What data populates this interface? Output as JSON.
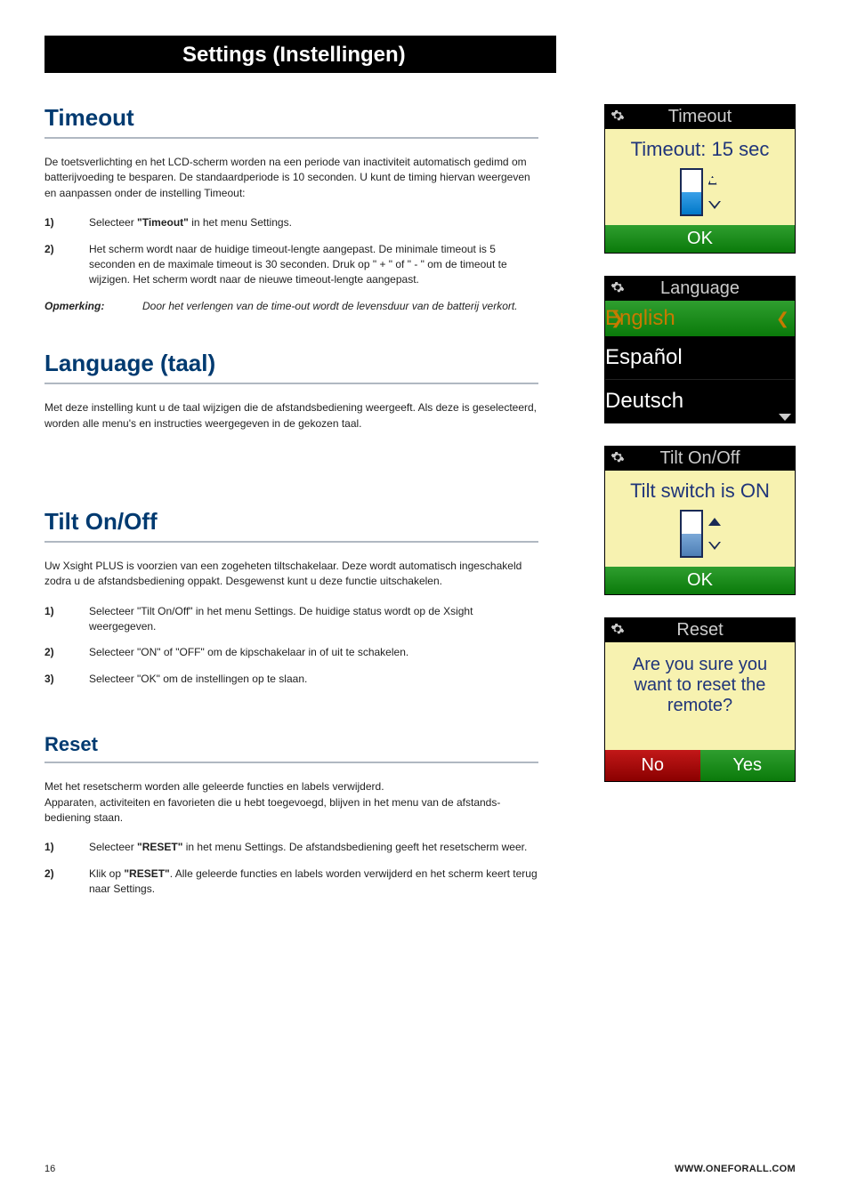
{
  "header": "Settings (Instellingen)",
  "sections": {
    "timeout": {
      "title": "Timeout",
      "intro": "De toetsverlichting en het LCD-scherm worden na een periode van inactiviteit automatisch gedimd om batterijvoeding te besparen. De standaardperiode is 10 seconden. U kunt de timing hiervan weergeven en aanpassen onder de instelling Timeout:",
      "steps": [
        {
          "num": "1)",
          "pre": "Selecteer ",
          "bold": "\"Timeout\"",
          "post": " in het menu Settings."
        },
        {
          "num": "2)",
          "text": "Het scherm wordt naar de huidige timeout-lengte aangepast. De minimale timeout is 5 seconden en de maximale timeout is 30 seconden. Druk op \" + \" of \" - \" om de timeout te wijzigen. Het scherm  wordt naar de nieuwe timeout-lengte aangepast."
        }
      ],
      "note_label": "Opmerking",
      "note_text": "Door het verlengen van de time-out wordt de levensduur van de batterij verkort."
    },
    "language": {
      "title": "Language (taal)",
      "intro": "Met deze instelling kunt u de taal wijzigen die de afstandsbediening weergeeft. Als deze is geselecteerd, worden alle menu's en instructies weergegeven in de gekozen taal."
    },
    "tilt": {
      "title": "Tilt On/Off",
      "intro": "Uw Xsight PLUS is voorzien van een zogeheten tiltschakelaar. Deze wordt automatisch ingeschakeld zodra u de afstandsbediening oppakt. Desgewenst kunt u deze functie uitschakelen.",
      "steps": [
        {
          "num": "1)",
          "text": "Selecteer \"Tilt On/Off\" in het menu Settings. De huidige status wordt op de Xsight weergegeven."
        },
        {
          "num": "2)",
          "text": "Selecteer \"ON\" of \"OFF\" om de kipschakelaar in of uit te schakelen."
        },
        {
          "num": "3)",
          "text": "Selecteer \"OK\" om de instellingen op te slaan."
        }
      ]
    },
    "reset": {
      "title": "Reset",
      "intro": "Met het resetscherm worden alle geleerde functies en labels verwijderd.\nApparaten, activiteiten en favorieten die u hebt toegevoegd, blijven in het menu van de afstands­bediening staan.",
      "steps": [
        {
          "num": "1)",
          "pre": "Selecteer ",
          "bold": "\"RESET\"",
          "post": " in het menu Settings. De afstandsbediening geeft het resetscherm weer."
        },
        {
          "num": "2)",
          "pre": "Klik op ",
          "bold": "\"RESET\"",
          "post": ". Alle geleerde functies en labels worden verwijderd en het scherm keert terug naar Settings."
        }
      ]
    }
  },
  "screens": {
    "timeout": {
      "title": "Timeout",
      "value": "Timeout: 15 sec",
      "ok": "OK"
    },
    "language": {
      "title": "Language",
      "selected": "English",
      "opt1": "Español",
      "opt2": "Deutsch"
    },
    "tilt": {
      "title": "Tilt On/Off",
      "value": "Tilt switch is ON",
      "ok": "OK"
    },
    "reset": {
      "title": "Reset",
      "question": "Are you sure you want to reset the remote?",
      "no": "No",
      "yes": "Yes"
    }
  },
  "footer": {
    "page": "16",
    "url": "WWW.ONEFORALL.COM"
  }
}
